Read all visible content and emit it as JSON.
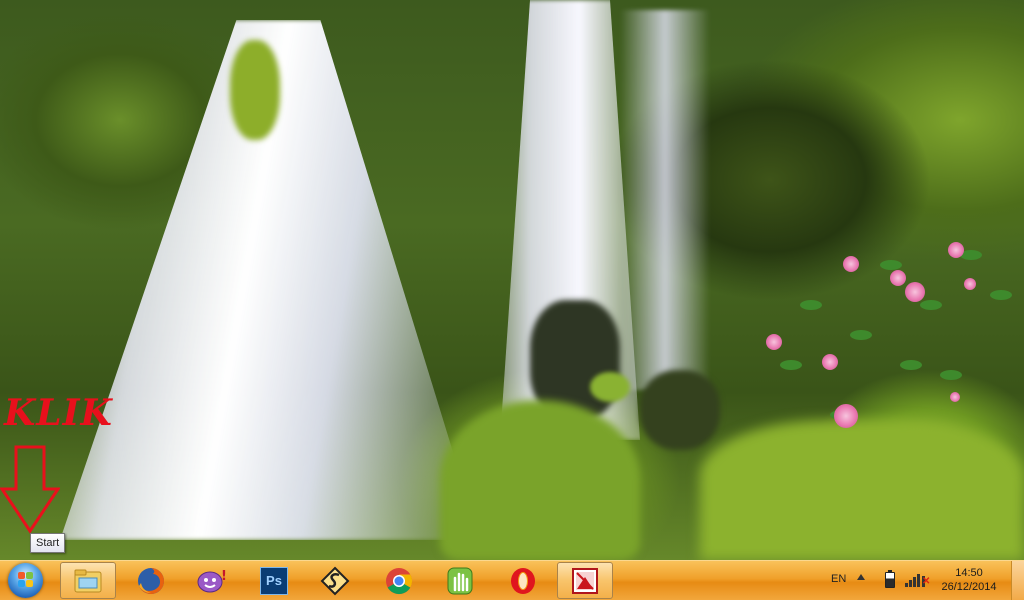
{
  "annotation": {
    "label": "KLIK",
    "tooltip": "Start",
    "color": "#e8101c"
  },
  "taskbar": {
    "color": "#f0a02a",
    "start": {
      "icon": "windows-orb-icon"
    },
    "pinned": [
      {
        "name": "windows-explorer",
        "icon": "folder-icon",
        "active": true
      },
      {
        "name": "firefox",
        "icon": "firefox-icon",
        "active": false
      },
      {
        "name": "yahoo-messenger",
        "icon": "yahoo-messenger-icon",
        "active": false
      },
      {
        "name": "photoshop",
        "icon": "photoshop-icon",
        "active": false
      },
      {
        "name": "app-yellow-s",
        "icon": "yellow-s-icon",
        "active": false
      },
      {
        "name": "chrome",
        "icon": "chrome-icon",
        "active": false
      },
      {
        "name": "app-green-hand",
        "icon": "green-hand-icon",
        "active": false
      },
      {
        "name": "opera",
        "icon": "opera-icon",
        "active": false
      },
      {
        "name": "app-red-picture",
        "icon": "red-picture-icon",
        "active": true
      }
    ],
    "tray": {
      "language": "EN",
      "show_hidden_icon": "chevron-up-icon",
      "battery_icon": "battery-icon",
      "network_icon": "network-signal-icon",
      "time": "14:50",
      "date": "26/12/2014"
    }
  },
  "photoshop_label": "Ps"
}
